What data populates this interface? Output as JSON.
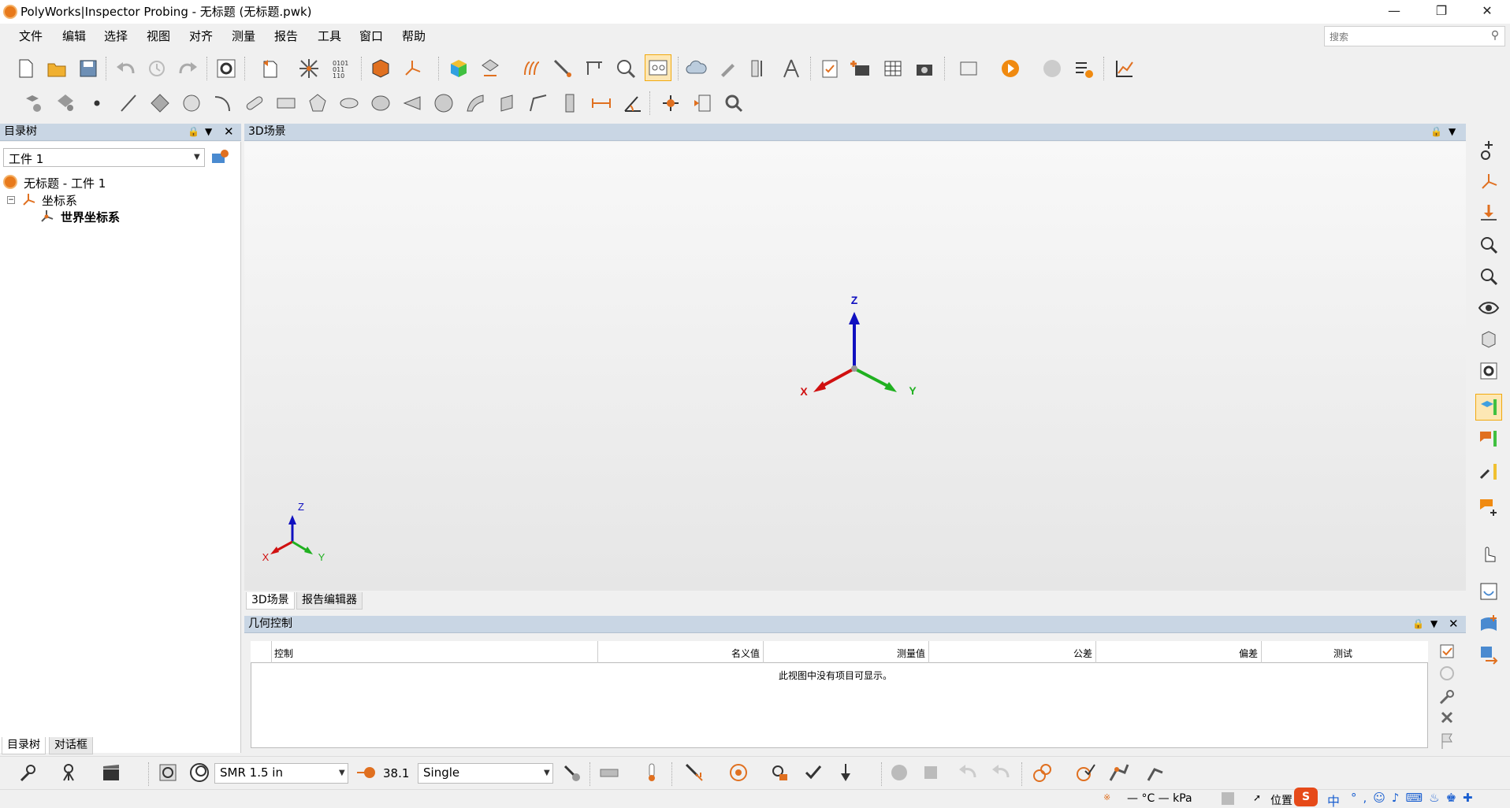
{
  "window": {
    "title": "PolyWorks|Inspector Probing - 无标题 (无标题.pwk)",
    "minimize": "—",
    "restore": "❐",
    "close": "✕"
  },
  "menu": [
    "文件",
    "编辑",
    "选择",
    "视图",
    "对齐",
    "测量",
    "报告",
    "工具",
    "窗口",
    "帮助"
  ],
  "search": {
    "placeholder": "搜索"
  },
  "tree_panel": {
    "title": "目录树",
    "piece_select": "工件 1",
    "root": "无标题 - 工件 1",
    "coord_group": "坐标系",
    "world_coord": "世界坐标系",
    "tabs": [
      "目录树",
      "对话框"
    ]
  },
  "scene_panel": {
    "title": "3D场景",
    "tabs": [
      "3D场景",
      "报告编辑器"
    ],
    "axes": {
      "x": "X",
      "y": "Y",
      "z": "Z"
    },
    "colors": {
      "x": "#d01010",
      "y": "#20b020",
      "z": "#1010c0"
    }
  },
  "geo_panel": {
    "title": "几何控制",
    "columns": [
      "控制",
      "名义值",
      "测量值",
      "公差",
      "偏差",
      "测试"
    ],
    "empty_message": "此视图中没有项目可显示。"
  },
  "bottom_toolbar": {
    "probe_select": "SMR 1.5 in",
    "probe_value": "38.1",
    "mode_select": "Single"
  },
  "status": {
    "readout": "— °C — kPa",
    "position_label": "位置",
    "ime": "中"
  }
}
